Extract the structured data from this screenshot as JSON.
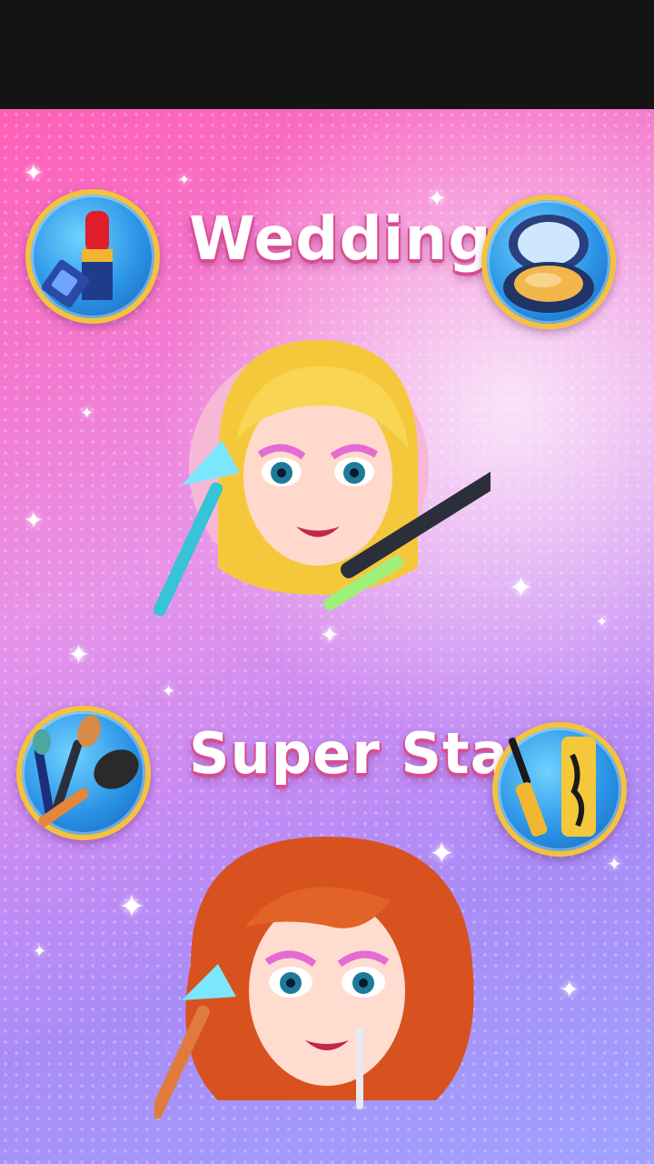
{
  "modes": [
    {
      "id": "wedding",
      "title": "Wedding"
    },
    {
      "id": "superstar",
      "title": "Super Star"
    }
  ],
  "icons": {
    "wedding_left": "lipstick-icon",
    "wedding_right": "compact-powder-icon",
    "superstar_left": "makeup-brushes-icon",
    "superstar_right": "mascara-icon"
  },
  "colors": {
    "title_shadow": "#d94c92",
    "tool_ring": "#f4c23d",
    "tool_fill": "#2b93e6"
  }
}
